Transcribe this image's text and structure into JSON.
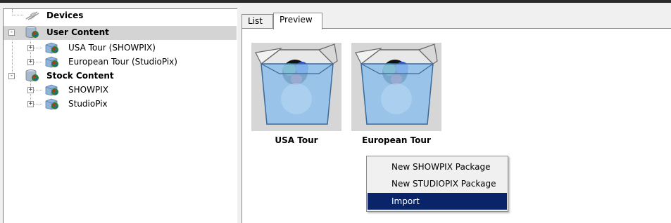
{
  "tree": {
    "items": [
      {
        "label": "Devices",
        "bold": true,
        "icon": "devices-icon"
      },
      {
        "label": "User Content",
        "bold": true,
        "icon": "database-icon",
        "expander": "-"
      },
      {
        "label": "USA Tour (SHOWPIX)",
        "bold": false,
        "icon": "package-icon",
        "expander": "+"
      },
      {
        "label": "European Tour (StudioPix)",
        "bold": false,
        "icon": "package-icon",
        "expander": "+"
      },
      {
        "label": "Stock Content",
        "bold": true,
        "icon": "database-icon",
        "expander": "-"
      },
      {
        "label": "SHOWPIX",
        "bold": false,
        "icon": "package-icon",
        "expander": "+"
      },
      {
        "label": "StudioPix",
        "bold": false,
        "icon": "package-icon",
        "expander": "+"
      }
    ]
  },
  "tabs": {
    "list": "List",
    "preview": "Preview"
  },
  "packages": [
    {
      "label": "USA Tour"
    },
    {
      "label": "European Tour"
    }
  ],
  "context_menu": {
    "items": [
      "New SHOWPIX Package",
      "New STUDIOPIX Package",
      "Import"
    ],
    "highlighted": "Import"
  },
  "colors": {
    "selection": "#0a246a",
    "tree_selected": "#d4d4d4"
  }
}
